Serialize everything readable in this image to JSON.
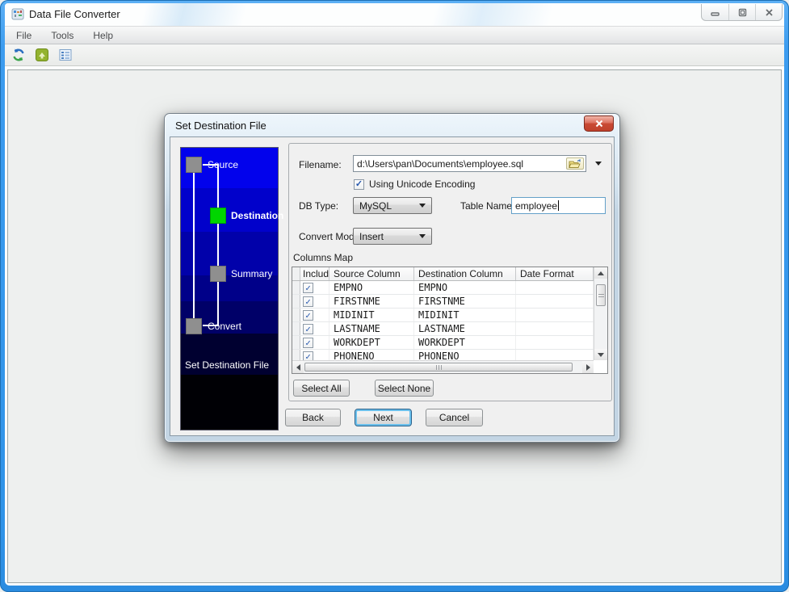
{
  "window": {
    "title": "Data File Converter",
    "controls": [
      {
        "name": "minimize"
      },
      {
        "name": "maximize"
      },
      {
        "name": "close"
      }
    ]
  },
  "menu": {
    "items": [
      {
        "label": "File"
      },
      {
        "label": "Tools"
      },
      {
        "label": "Help"
      }
    ]
  },
  "toolbar": {
    "buttons": [
      {
        "icon": "convert-arrows-icon"
      },
      {
        "icon": "open-file-icon"
      },
      {
        "icon": "columns-list-icon"
      }
    ]
  },
  "dialog": {
    "title": "Set Destination File",
    "steps": [
      {
        "label": "Source",
        "state": "inactive"
      },
      {
        "label": "Destination",
        "state": "active"
      },
      {
        "label": "Summary",
        "state": "inactive"
      },
      {
        "label": "Convert",
        "state": "inactive"
      }
    ],
    "step_caption": "Set Destination File",
    "form": {
      "filename_label": "Filename:",
      "filename_value": "d:\\Users\\pan\\Documents\\employee.sql",
      "unicode_label": "Using Unicode Encoding",
      "unicode_checked": true,
      "db_type_label": "DB Type:",
      "db_type_value": "MySQL",
      "table_name_label": "Table Name:",
      "table_name_value": "employee",
      "convert_mode_label": "Convert Mode:",
      "convert_mode_value": "Insert",
      "columns_map_label": "Columns Map",
      "grid": {
        "headers": [
          "Include",
          "Source Column",
          "Destination Column",
          "Date Format"
        ],
        "rows": [
          {
            "include": true,
            "source": "EMPNO",
            "destination": "EMPNO",
            "date_format": ""
          },
          {
            "include": true,
            "source": "FIRSTNME",
            "destination": "FIRSTNME",
            "date_format": ""
          },
          {
            "include": true,
            "source": "MIDINIT",
            "destination": "MIDINIT",
            "date_format": ""
          },
          {
            "include": true,
            "source": "LASTNAME",
            "destination": "LASTNAME",
            "date_format": ""
          },
          {
            "include": true,
            "source": "WORKDEPT",
            "destination": "WORKDEPT",
            "date_format": ""
          },
          {
            "include": true,
            "source": "PHONENO",
            "destination": "PHONENO",
            "date_format": ""
          }
        ]
      },
      "select_all_label": "Select All",
      "select_none_label": "Select None"
    },
    "buttons": {
      "back": "Back",
      "next": "Next",
      "cancel": "Cancel"
    }
  },
  "glyphs": {
    "check": "✓"
  },
  "colors": {
    "frame_blue": "#2f93e8",
    "sidebar_top_blue": "#0202ec",
    "sidebar_bottom": "#000005",
    "active_step_green": "#00d600",
    "close_button_red": "#c94a35",
    "focus_ring_blue": "#6bc0ec"
  }
}
